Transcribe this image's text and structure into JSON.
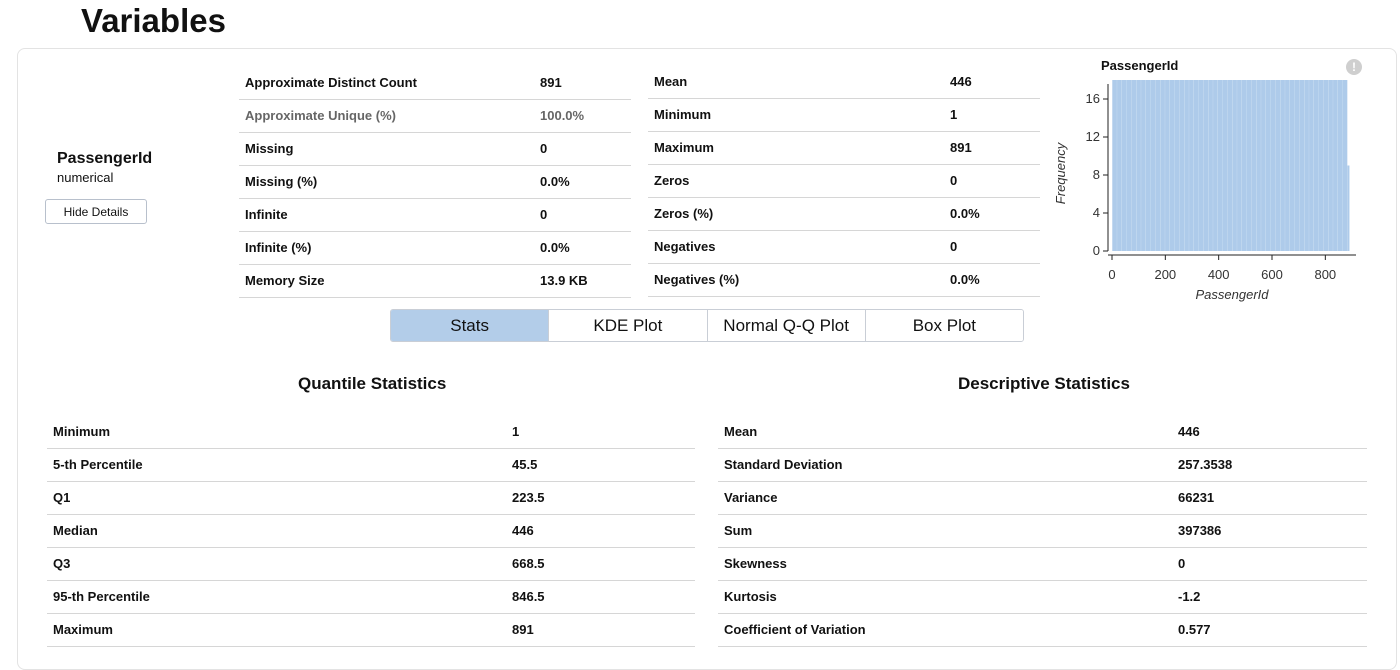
{
  "page": {
    "title": "Variables"
  },
  "variable": {
    "name": "PassengerId",
    "type": "numerical",
    "hide_details_label": "Hide Details"
  },
  "overview_left": [
    {
      "label": "Approximate Distinct Count",
      "value": "891"
    },
    {
      "label": "Approximate Unique (%)",
      "value": "100.0%"
    },
    {
      "label": "Missing",
      "value": "0"
    },
    {
      "label": "Missing (%)",
      "value": "0.0%"
    },
    {
      "label": "Infinite",
      "value": "0"
    },
    {
      "label": "Infinite (%)",
      "value": "0.0%"
    },
    {
      "label": "Memory Size",
      "value": "13.9 KB"
    }
  ],
  "overview_right": [
    {
      "label": "Mean",
      "value": "446"
    },
    {
      "label": "Minimum",
      "value": "1"
    },
    {
      "label": "Maximum",
      "value": "891"
    },
    {
      "label": "Zeros",
      "value": "0"
    },
    {
      "label": "Zeros (%)",
      "value": "0.0%"
    },
    {
      "label": "Negatives",
      "value": "0"
    },
    {
      "label": "Negatives (%)",
      "value": "0.0%"
    }
  ],
  "histogram": {
    "title": "PassengerId",
    "info_icon": "info-icon",
    "chart_data": {
      "type": "bar",
      "title": "PassengerId",
      "xlabel": "PassengerId",
      "ylabel": "Frequency",
      "x_ticks": [
        "0",
        "200",
        "400",
        "600",
        "800"
      ],
      "y_ticks": [
        "0",
        "4",
        "8",
        "12",
        "16"
      ],
      "xlim": [
        1,
        891
      ],
      "ylim": [
        0,
        18
      ],
      "bin_width": 18,
      "values": [
        18,
        18,
        18,
        18,
        18,
        18,
        18,
        18,
        18,
        18,
        18,
        18,
        18,
        18,
        18,
        18,
        18,
        18,
        18,
        18,
        18,
        18,
        18,
        18,
        18,
        18,
        18,
        18,
        18,
        18,
        18,
        18,
        18,
        18,
        18,
        18,
        18,
        18,
        18,
        18,
        18,
        18,
        18,
        18,
        18,
        18,
        18,
        18,
        18,
        9
      ],
      "bar_color": "#aecbea",
      "grid": false
    }
  },
  "tabs": [
    {
      "label": "Stats",
      "active": true
    },
    {
      "label": "KDE Plot",
      "active": false
    },
    {
      "label": "Normal Q-Q Plot",
      "active": false
    },
    {
      "label": "Box Plot",
      "active": false
    }
  ],
  "quantile": {
    "title": "Quantile Statistics",
    "rows": [
      {
        "label": "Minimum",
        "value": "1"
      },
      {
        "label": "5-th Percentile",
        "value": "45.5"
      },
      {
        "label": "Q1",
        "value": "223.5"
      },
      {
        "label": "Median",
        "value": "446"
      },
      {
        "label": "Q3",
        "value": "668.5"
      },
      {
        "label": "95-th Percentile",
        "value": "846.5"
      },
      {
        "label": "Maximum",
        "value": "891"
      }
    ]
  },
  "descriptive": {
    "title": "Descriptive Statistics",
    "rows": [
      {
        "label": "Mean",
        "value": "446"
      },
      {
        "label": "Standard Deviation",
        "value": "257.3538"
      },
      {
        "label": "Variance",
        "value": "66231"
      },
      {
        "label": "Sum",
        "value": "397386"
      },
      {
        "label": "Skewness",
        "value": "0"
      },
      {
        "label": "Kurtosis",
        "value": "-1.2"
      },
      {
        "label": "Coefficient of Variation",
        "value": "0.577"
      }
    ]
  }
}
